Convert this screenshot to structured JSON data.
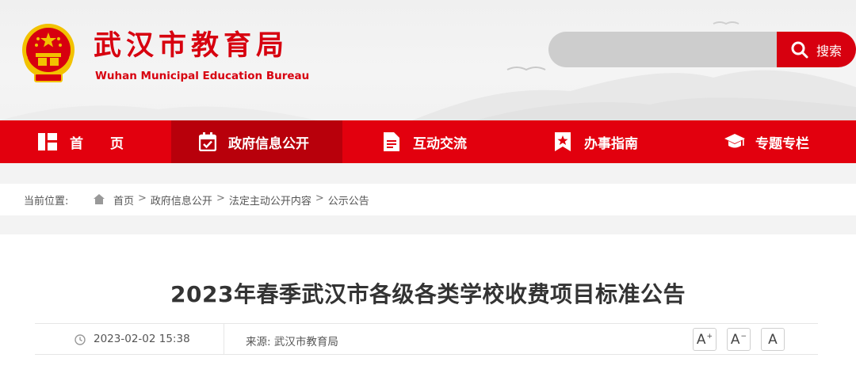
{
  "header": {
    "title": "武汉市教育局",
    "subtitle": "Wuhan Municipal Education Bureau",
    "search": {
      "placeholder": "",
      "button_label": "搜索"
    }
  },
  "nav": {
    "items": [
      {
        "label": "首　　页",
        "icon": "grid-icon"
      },
      {
        "label": "政府信息公开",
        "icon": "calendar-check-icon",
        "active": true
      },
      {
        "label": "互动交流",
        "icon": "document-icon"
      },
      {
        "label": "办事指南",
        "icon": "bookmark-star-icon"
      },
      {
        "label": "专题专栏",
        "icon": "graduation-cap-icon"
      }
    ]
  },
  "breadcrumb": {
    "lead": "当前位置:",
    "items": [
      "首页",
      "政府信息公开",
      "法定主动公开内容",
      "公示公告"
    ],
    "separator": ">"
  },
  "article": {
    "title": "2023年春季武汉市各级各类学校收费项目标准公告",
    "date": "2023-02-02 15:38",
    "source": "来源:  武汉市教育局",
    "font_controls": [
      "A",
      "A",
      "A"
    ]
  },
  "colors": {
    "brand_red": "#e2000e",
    "nav_active": "#b8000b",
    "search_bg": "#cdcdcd"
  }
}
